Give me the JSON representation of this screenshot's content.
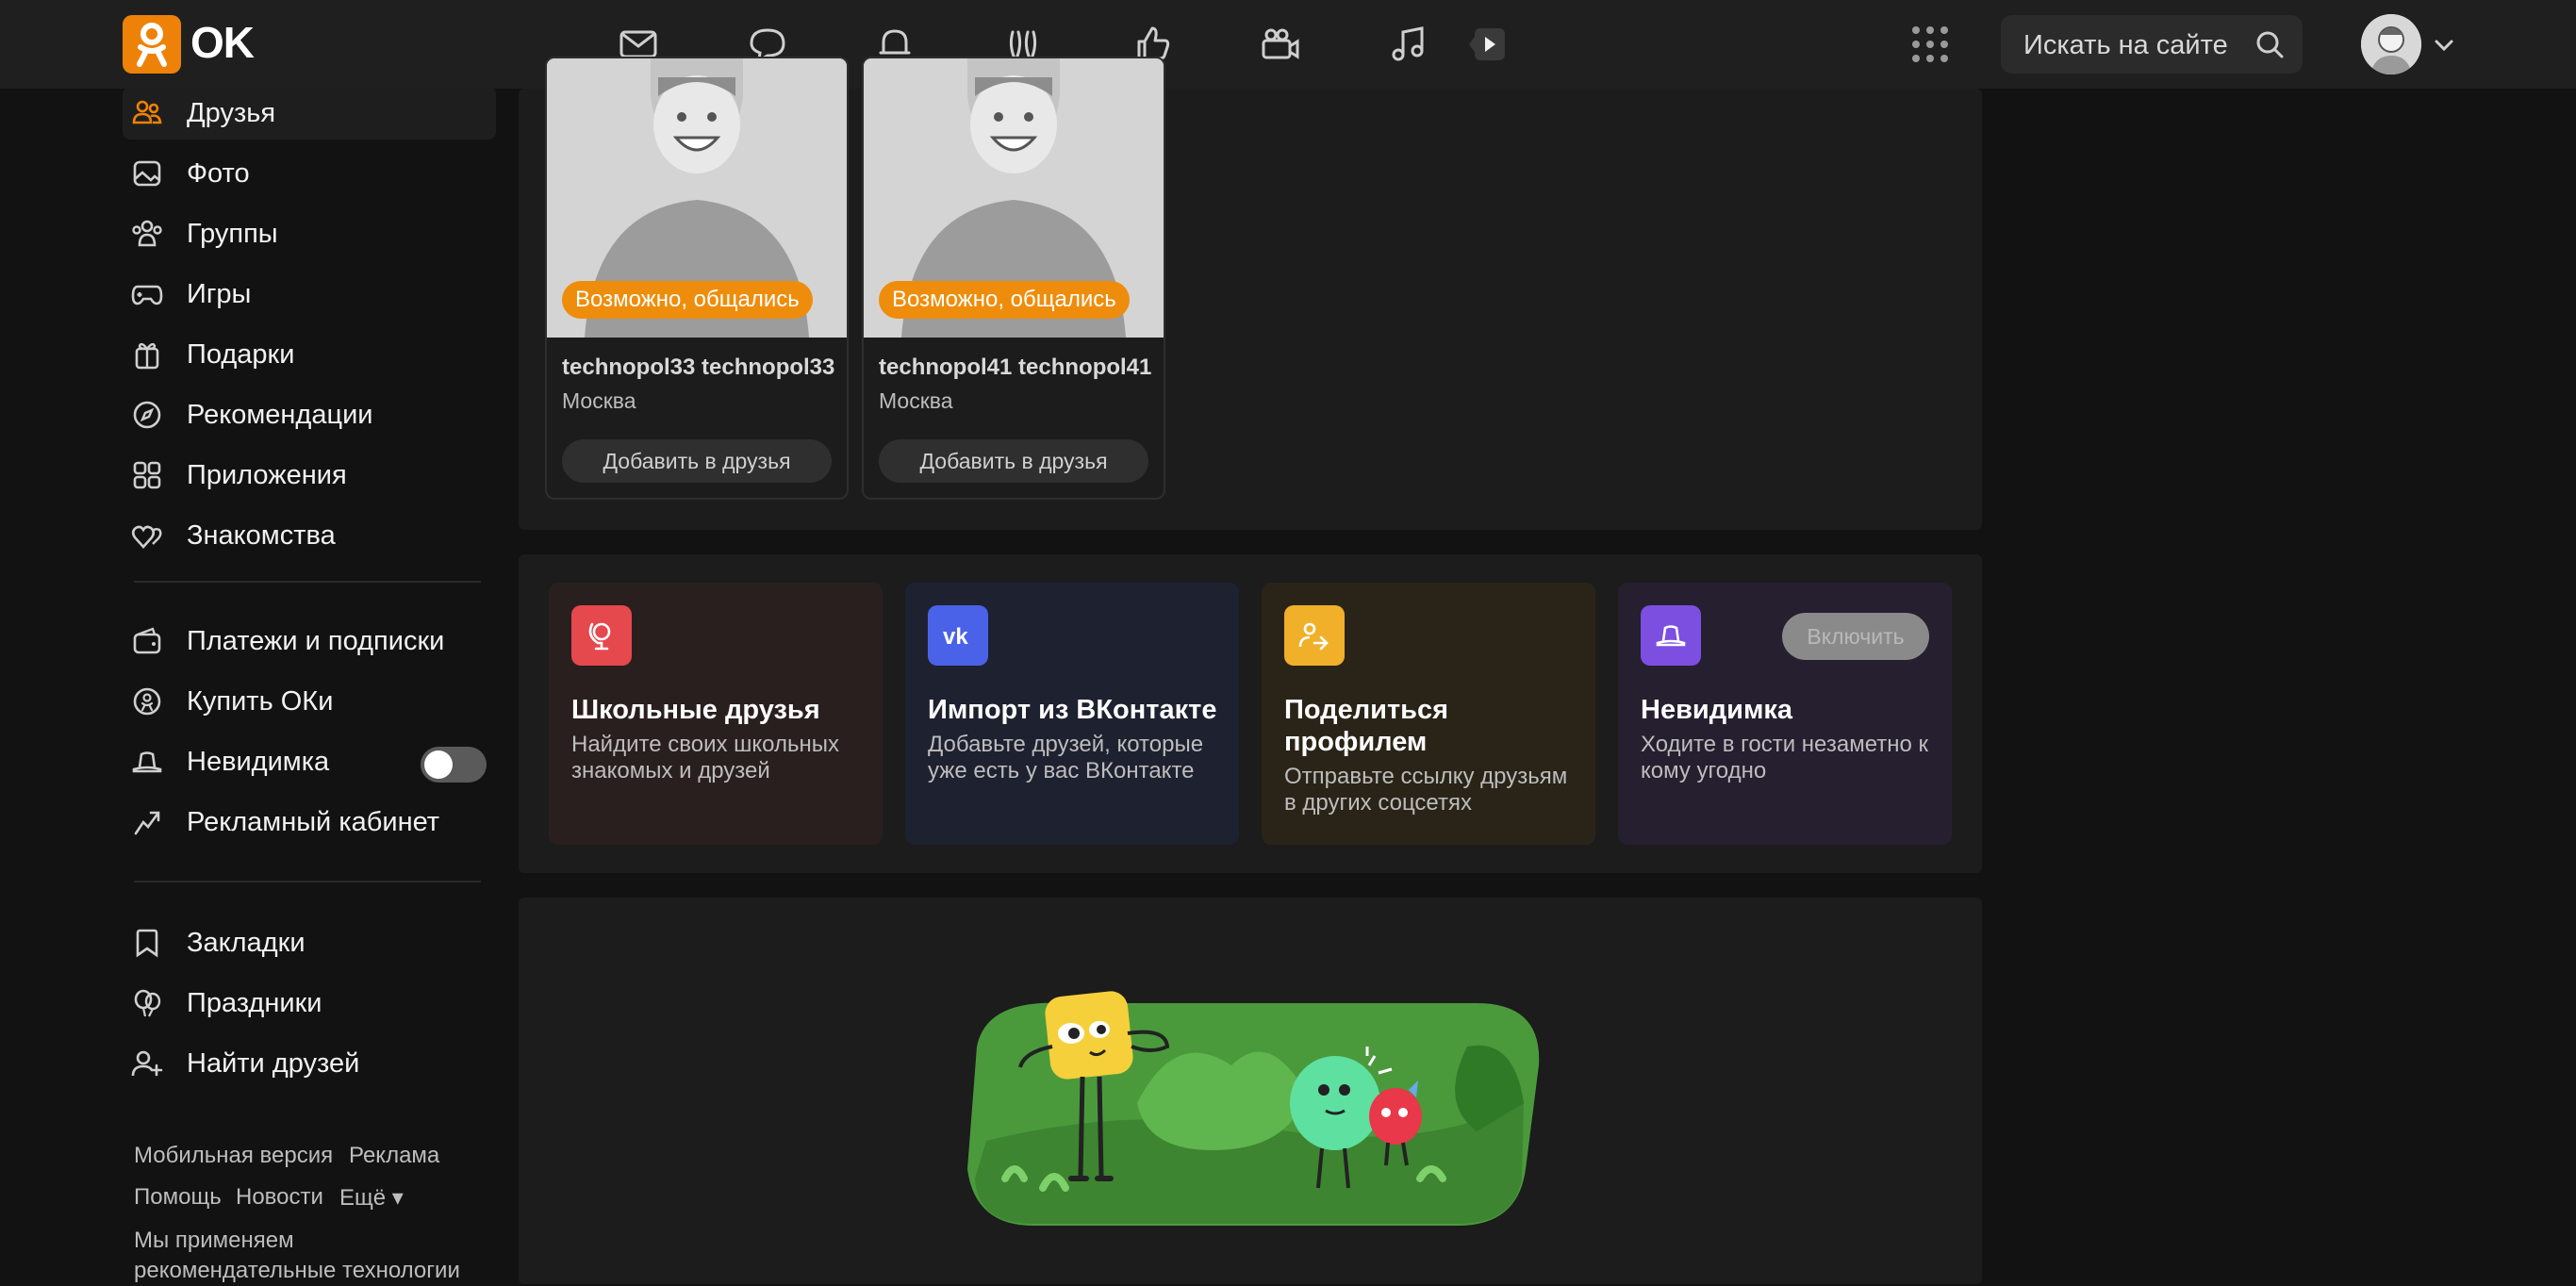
{
  "brand": {
    "logo_text": "OK",
    "accent": "#ee8208"
  },
  "header": {
    "search_placeholder": "Искать на сайте",
    "nav_icons": [
      "mail-icon",
      "chat-icon",
      "bell-icon",
      "guests-icon",
      "like-icon",
      "video-camera-icon",
      "music-icon",
      "video-play-icon"
    ]
  },
  "sidebar": {
    "items": [
      {
        "label": "Друзья",
        "icon": "friends-icon"
      },
      {
        "label": "Фото",
        "icon": "photo-icon"
      },
      {
        "label": "Группы",
        "icon": "groups-icon"
      },
      {
        "label": "Игры",
        "icon": "gamepad-icon"
      },
      {
        "label": "Подарки",
        "icon": "gift-icon"
      },
      {
        "label": "Рекомендации",
        "icon": "compass-icon"
      },
      {
        "label": "Приложения",
        "icon": "apps-icon"
      },
      {
        "label": "Знакомства",
        "icon": "hearts-icon"
      }
    ],
    "items2": [
      {
        "label": "Платежи и подписки",
        "icon": "wallet-icon"
      },
      {
        "label": "Купить ОКи",
        "icon": "ok-coin-icon"
      },
      {
        "label": "Невидимка",
        "icon": "hat-icon"
      },
      {
        "label": "Рекламный кабинет",
        "icon": "ads-icon"
      }
    ],
    "items3": [
      {
        "label": "Закладки",
        "icon": "bookmark-icon"
      },
      {
        "label": "Праздники",
        "icon": "balloons-icon"
      },
      {
        "label": "Найти друзей",
        "icon": "add-friend-icon"
      }
    ],
    "footer": {
      "mobile": "Мобильная версия",
      "ads": "Реклама",
      "help": "Помощь",
      "news": "Новости",
      "more": "Ещё ▾",
      "note": "Мы применяем рекомендательные технологии"
    }
  },
  "suggestions": [
    {
      "badge": "Возможно, общались",
      "name": "technopol33 technopol33",
      "city": "Москва",
      "button": "Добавить в друзья"
    },
    {
      "badge": "Возможно, общались",
      "name": "technopol41 technopol41",
      "city": "Москва",
      "button": "Добавить в друзья"
    }
  ],
  "features": [
    {
      "title": "Школьные друзья",
      "desc": "Найдите своих школьных знакомых и друзей",
      "icon": "school-globe-icon",
      "icon_color": "#e5484d",
      "bg": "#2a1f1f"
    },
    {
      "title": "Импорт из ВКонтакте",
      "desc": "Добавьте друзей, которые уже есть у вас ВКонтакте",
      "icon": "vk-icon",
      "icon_color": "#4a62e8",
      "bg": "#1e2130"
    },
    {
      "title": "Поделиться профилем",
      "desc": "Отправьте ссылку друзьям в других соцсетях",
      "icon": "share-profile-icon",
      "icon_color": "#f0b02a",
      "bg": "#2a2418"
    },
    {
      "title": "Невидимка",
      "desc": "Ходите в гости незаметно к кому угодно",
      "icon": "invisible-hat-icon",
      "icon_color": "#7d4fe0",
      "bg": "#251f30",
      "button": "Включить"
    }
  ]
}
